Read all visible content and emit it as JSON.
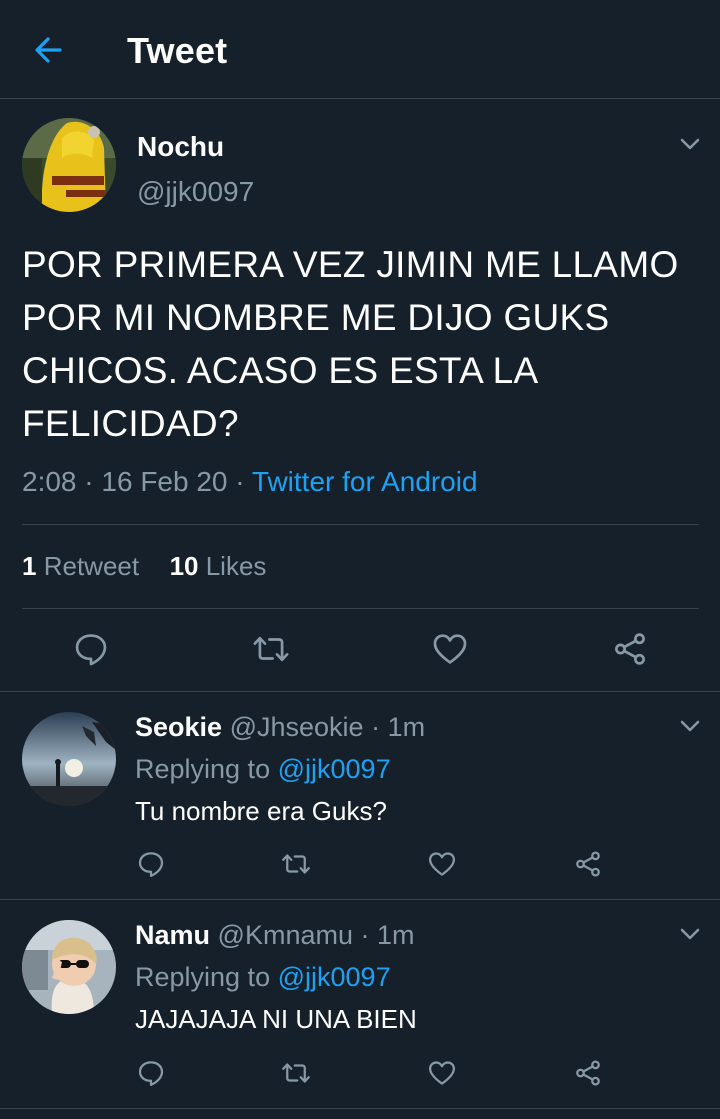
{
  "header": {
    "title": "Tweet",
    "back_icon": "arrow-left-icon",
    "accent": "#1da1f2"
  },
  "main_tweet": {
    "author_name": "Nochu",
    "author_handle": "@jjk0097",
    "text": "POR PRIMERA VEZ JIMIN ME LLAMO POR MI NOMBRE ME DIJO GUKS CHICOS. ACASO ES ESTA LA FELICIDAD?",
    "time": "2:08",
    "date": "16 Feb 20",
    "separator": "·",
    "source": "Twitter for Android",
    "retweets_count": "1",
    "retweets_label": "Retweet",
    "likes_count": "10",
    "likes_label": "Likes"
  },
  "replies": [
    {
      "name": "Seokie",
      "handle": "@Jhseokie",
      "time": "1m",
      "separator": "·",
      "replying_label": "Replying to",
      "mention": "@jjk0097",
      "text": "Tu nombre era Guks?"
    },
    {
      "name": "Namu",
      "handle": "@Kmnamu",
      "time": "1m",
      "separator": "·",
      "replying_label": "Replying to",
      "mention": "@jjk0097",
      "text": "JAJAJAJA NI UNA BIEN"
    }
  ],
  "actions": [
    "reply-icon",
    "retweet-icon",
    "like-icon",
    "share-icon"
  ],
  "colors": {
    "background": "#15202b",
    "divider": "#38444d",
    "secondary_text": "#8899a6",
    "link": "#1da1f2"
  }
}
